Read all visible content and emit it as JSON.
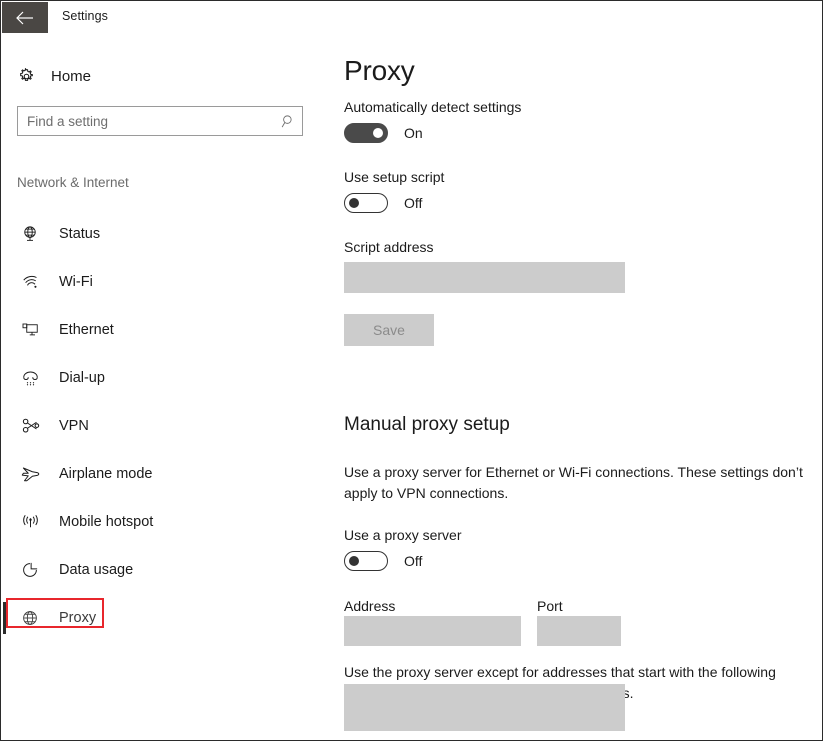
{
  "window": {
    "title": "Settings",
    "back_icon": "back-arrow-icon"
  },
  "sidebar": {
    "home": {
      "label": "Home",
      "icon": "gear-icon"
    },
    "search": {
      "placeholder": "Find a setting",
      "value": "",
      "icon": "search-icon"
    },
    "group_title": "Network & Internet",
    "items": [
      {
        "label": "Status",
        "icon": "globe-network-icon",
        "selected": false
      },
      {
        "label": "Wi-Fi",
        "icon": "wifi-icon",
        "selected": false
      },
      {
        "label": "Ethernet",
        "icon": "ethernet-icon",
        "selected": false
      },
      {
        "label": "Dial-up",
        "icon": "dialup-phone-icon",
        "selected": false
      },
      {
        "label": "VPN",
        "icon": "vpn-key-icon",
        "selected": false
      },
      {
        "label": "Airplane mode",
        "icon": "airplane-icon",
        "selected": false
      },
      {
        "label": "Mobile hotspot",
        "icon": "hotspot-icon",
        "selected": false
      },
      {
        "label": "Data usage",
        "icon": "pie-chart-icon",
        "selected": false
      },
      {
        "label": "Proxy",
        "icon": "globe-icon",
        "selected": true
      }
    ]
  },
  "main": {
    "page_title": "Proxy",
    "auto_detect": {
      "label": "Automatically detect settings",
      "state": "On",
      "on": true
    },
    "setup_script": {
      "label": "Use setup script",
      "state": "Off",
      "on": false
    },
    "script_address": {
      "label": "Script address",
      "value": ""
    },
    "save_label": "Save",
    "manual": {
      "heading": "Manual proxy setup",
      "description": "Use a proxy server for Ethernet or Wi-Fi connections. These settings don’t apply to VPN connections.",
      "use_proxy": {
        "label": "Use a proxy server",
        "state": "Off",
        "on": false
      },
      "address": {
        "label": "Address",
        "value": ""
      },
      "port": {
        "label": "Port",
        "value": ""
      },
      "exceptions_description": "Use the proxy server except for addresses that start with the following entries. Use semicolons (;) to separate entries.",
      "exceptions": {
        "value": ""
      }
    }
  },
  "colors": {
    "highlight": "#e8262c",
    "titlebar_button": "#4a4744",
    "toggle_on": "#4a4a4a",
    "field_disabled": "#cccccc"
  }
}
